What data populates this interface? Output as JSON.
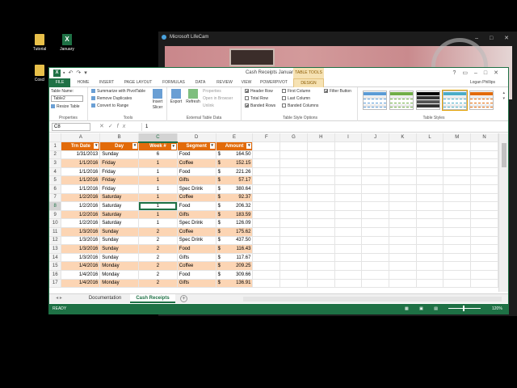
{
  "desktop": {
    "icons": [
      {
        "label": "Tutorial",
        "icon": "folder-icon"
      },
      {
        "label": "January",
        "icon": "excel-file-icon"
      },
      {
        "label": "Coscl",
        "icon": "folder-icon"
      }
    ]
  },
  "lifecam": {
    "title": "Microsoft LifeCam"
  },
  "excel": {
    "title": "Cash Receipts January - Excel",
    "context_tab_header": "TABLE TOOLS",
    "user": "Logan Phillips",
    "tabs": [
      "FILE",
      "HOME",
      "INSERT",
      "PAGE LAYOUT",
      "FORMULAS",
      "DATA",
      "REVIEW",
      "VIEW",
      "POWERPIVOT",
      "DESIGN"
    ],
    "ribbon": {
      "properties": {
        "label": "Properties",
        "table_name_label": "Table Name:",
        "table_name_value": "Table2",
        "resize_label": "Resize Table"
      },
      "tools": {
        "label": "Tools",
        "items": [
          "Summarize with PivotTable",
          "Remove Duplicates",
          "Convert to Range"
        ],
        "insert_slicer": "Insert Slicer"
      },
      "external": {
        "label": "External Table Data",
        "export": "Export",
        "refresh": "Refresh",
        "items": [
          "Properties",
          "Open in Browser",
          "Unlink"
        ]
      },
      "style_options": {
        "label": "Table Style Options",
        "checkboxes": [
          {
            "label": "Header Row",
            "checked": true
          },
          {
            "label": "Total Row",
            "checked": false
          },
          {
            "label": "Banded Rows",
            "checked": true
          },
          {
            "label": "First Column",
            "checked": false
          },
          {
            "label": "Last Column",
            "checked": false
          },
          {
            "label": "Banded Columns",
            "checked": false
          },
          {
            "label": "Filter Button",
            "checked": true
          }
        ]
      },
      "table_styles": {
        "label": "Table Styles",
        "swatch_colors": [
          "#5b9bd5",
          "#70ad47",
          "#000000",
          "#4bacc6",
          "#e26b0a"
        ]
      }
    },
    "formula_bar": {
      "name_box": "C8",
      "value": "1"
    },
    "grid": {
      "columns": [
        "A",
        "B",
        "C",
        "D",
        "E",
        "F",
        "G",
        "H",
        "I",
        "J",
        "K",
        "L",
        "M",
        "N"
      ],
      "selected_column": "C",
      "selected_row": "8",
      "headers": [
        "Trn Date",
        "Day",
        "Week #",
        "Segment",
        "Amount"
      ],
      "currency_symbol": "$",
      "rows": [
        {
          "n": "2",
          "date": "1/31/2013",
          "day": "Sunday",
          "week": "6",
          "segment": "Food",
          "amount": "164.50"
        },
        {
          "n": "3",
          "date": "1/1/2016",
          "day": "Friday",
          "week": "1",
          "segment": "Coffee",
          "amount": "152.15"
        },
        {
          "n": "4",
          "date": "1/1/2016",
          "day": "Friday",
          "week": "1",
          "segment": "Food",
          "amount": "221.26"
        },
        {
          "n": "5",
          "date": "1/1/2016",
          "day": "Friday",
          "week": "1",
          "segment": "Gifts",
          "amount": "57.17"
        },
        {
          "n": "6",
          "date": "1/1/2016",
          "day": "Friday",
          "week": "1",
          "segment": "Spec Drink",
          "amount": "380.64"
        },
        {
          "n": "7",
          "date": "1/2/2016",
          "day": "Saturday",
          "week": "1",
          "segment": "Coffee",
          "amount": "92.37"
        },
        {
          "n": "8",
          "date": "1/2/2016",
          "day": "Saturday",
          "week": "1",
          "segment": "Food",
          "amount": "206.32"
        },
        {
          "n": "9",
          "date": "1/2/2016",
          "day": "Saturday",
          "week": "1",
          "segment": "Gifts",
          "amount": "183.59"
        },
        {
          "n": "10",
          "date": "1/2/2016",
          "day": "Saturday",
          "week": "1",
          "segment": "Spec Drink",
          "amount": "126.09"
        },
        {
          "n": "11",
          "date": "1/3/2016",
          "day": "Sunday",
          "week": "2",
          "segment": "Coffee",
          "amount": "175.62"
        },
        {
          "n": "12",
          "date": "1/3/2016",
          "day": "Sunday",
          "week": "2",
          "segment": "Spec Drink",
          "amount": "437.50"
        },
        {
          "n": "13",
          "date": "1/3/2016",
          "day": "Sunday",
          "week": "2",
          "segment": "Food",
          "amount": "116.43"
        },
        {
          "n": "14",
          "date": "1/3/2016",
          "day": "Sunday",
          "week": "2",
          "segment": "Gifts",
          "amount": "117.67"
        },
        {
          "n": "15",
          "date": "1/4/2016",
          "day": "Monday",
          "week": "2",
          "segment": "Coffee",
          "amount": "209.25"
        },
        {
          "n": "16",
          "date": "1/4/2016",
          "day": "Monday",
          "week": "2",
          "segment": "Food",
          "amount": "309.66"
        },
        {
          "n": "17",
          "date": "1/4/2016",
          "day": "Monday",
          "week": "2",
          "segment": "Gifts",
          "amount": "136.91"
        }
      ]
    },
    "sheet_tabs": [
      "Documentation",
      "Cash Receipts"
    ],
    "active_sheet": "Cash Receipts",
    "status": {
      "ready": "READY",
      "zoom": "120%"
    },
    "colors": {
      "accent": "#1e7145",
      "table_header": "#e26b0a",
      "band": "#fcd5b4"
    }
  }
}
